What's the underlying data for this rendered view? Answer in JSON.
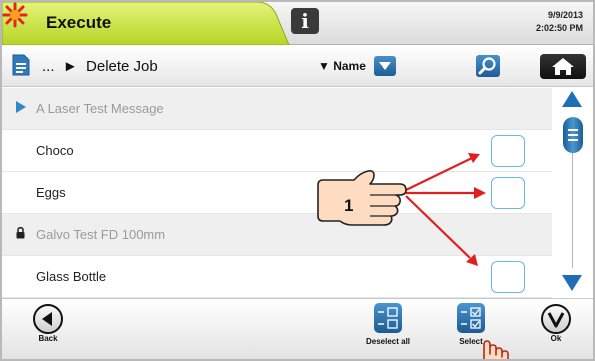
{
  "header": {
    "title": "Execute",
    "date": "9/9/2013",
    "time": "2:02:50 PM"
  },
  "toolbar": {
    "breadcrumb": "...  ►  Delete Job",
    "sort_label": "▼ Name"
  },
  "rows": [
    {
      "type": "folder",
      "label": "A Laser Test Message"
    },
    {
      "type": "item",
      "label": "Choco"
    },
    {
      "type": "item",
      "label": "Eggs"
    },
    {
      "type": "locked-folder",
      "label": "Galvo Test FD 100mm"
    },
    {
      "type": "item",
      "label": "Glass Bottle"
    }
  ],
  "footer": {
    "back_label": "Back",
    "deselect_label": "Deselect all",
    "select_label": "Select",
    "ok_label": "Ok"
  },
  "annotation": {
    "callout_number": "1"
  },
  "colors": {
    "header_tab": "#c8e635",
    "accent_blue": "#1e6fb5",
    "checkbox_border": "#6fb6e3",
    "arrow_red": "#e02020",
    "star_red": "#e8231e"
  }
}
